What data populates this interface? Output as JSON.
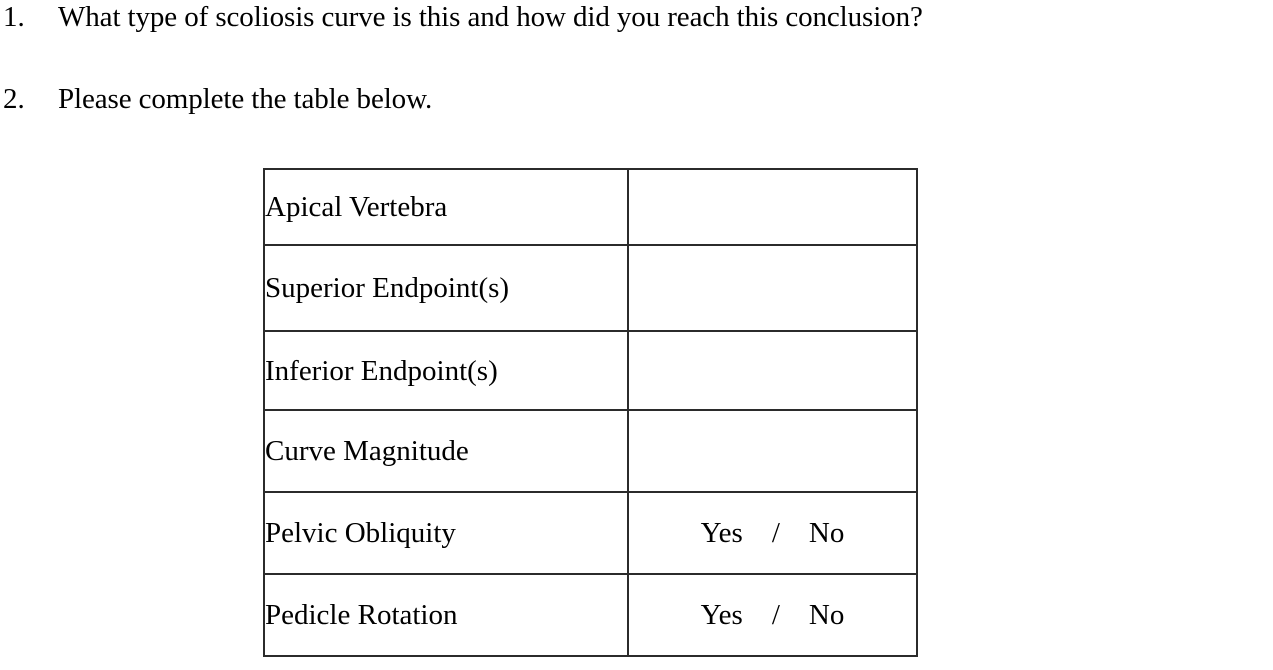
{
  "document": {
    "background_color": "#ffffff",
    "text_color": "#000000",
    "border_color": "#2b2b2b"
  },
  "questions": [
    {
      "marker": "1.",
      "text": "What type of scoliosis curve is this and how did you reach this conclusion?"
    },
    {
      "marker": "2.",
      "text": "Please complete the table below."
    }
  ],
  "table": {
    "rows": [
      {
        "label": "Apical Vertebra",
        "value": ""
      },
      {
        "label": "Superior Endpoint(s)",
        "value": ""
      },
      {
        "label": "Inferior Endpoint(s)",
        "value": ""
      },
      {
        "label": "Curve Magnitude",
        "value": ""
      },
      {
        "label": "Pelvic Obliquity",
        "value": "Yes    /    No"
      },
      {
        "label": "Pedicle Rotation",
        "value": "Yes    /    No"
      }
    ]
  }
}
